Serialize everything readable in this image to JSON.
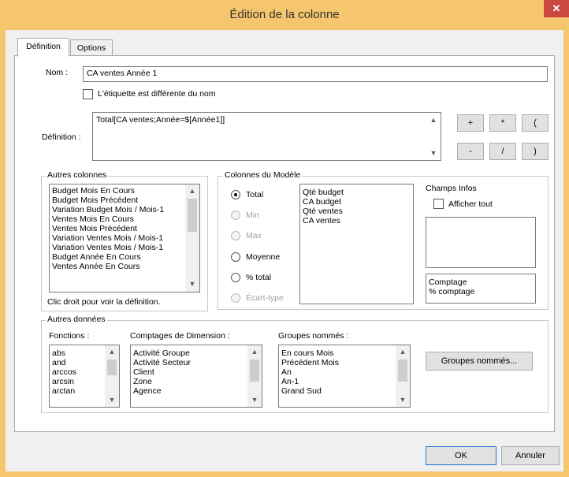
{
  "window": {
    "title": "Édition de la colonne",
    "close_glyph": "✕"
  },
  "tabs": [
    {
      "label": "Définition"
    },
    {
      "label": "Options"
    }
  ],
  "nom": {
    "label": "Nom :",
    "value": "CA ventes Année 1"
  },
  "etiquette": {
    "label": "L'étiquette est différente du nom",
    "checked": false
  },
  "definition": {
    "label": "Définition :",
    "value": "Total[CA ventes;Année=$[Année1]]"
  },
  "operators": [
    "+",
    "*",
    "(",
    "-",
    "/",
    ")"
  ],
  "autres_colonnes": {
    "title": "Autres colonnes",
    "items": [
      "Budget Mois En Cours",
      "Budget Mois Précédent",
      "Variation Budget Mois / Mois-1",
      "Ventes Mois En Cours",
      "Ventes Mois Précédent",
      "Variation Ventes Mois / Mois-1",
      "Variation Ventes Mois / Mois-1",
      "Budget Année En Cours",
      "Ventes Année En Cours"
    ],
    "hint": "Clic droit pour voir la définition."
  },
  "colonnes_modele": {
    "title": "Colonnes du Modèle",
    "radios": [
      {
        "label": "Total",
        "selected": true,
        "enabled": true
      },
      {
        "label": "Min",
        "selected": false,
        "enabled": false
      },
      {
        "label": "Max",
        "selected": false,
        "enabled": false
      },
      {
        "label": "Moyenne",
        "selected": false,
        "enabled": true
      },
      {
        "label": "% total",
        "selected": false,
        "enabled": true
      },
      {
        "label": "Écart-type",
        "selected": false,
        "enabled": false
      }
    ],
    "items": [
      "Qté budget",
      "CA budget",
      "Qté ventes",
      "CA ventes"
    ]
  },
  "champs_infos": {
    "title": "Champs Infos",
    "afficher_tout": {
      "label": "Afficher tout",
      "checked": false
    },
    "items": [
      "Comptage",
      "% comptage"
    ]
  },
  "autres_donnees": {
    "title": "Autres données",
    "fonctions": {
      "label": "Fonctions :",
      "items": [
        "abs",
        "and",
        "arccos",
        "arcsin",
        "arctan"
      ]
    },
    "comptages": {
      "label": "Comptages de Dimension :",
      "items": [
        "Activité Groupe",
        "Activité Secteur",
        "Client",
        "Zone",
        "Agence"
      ]
    },
    "groupes": {
      "label": "Groupes nommés :",
      "items": [
        "En cours Mois",
        "Précédent Mois",
        "An",
        "An-1",
        "Grand Sud"
      ]
    },
    "groupes_button": "Groupes nommés..."
  },
  "buttons": {
    "ok": "OK",
    "cancel": "Annuler"
  }
}
